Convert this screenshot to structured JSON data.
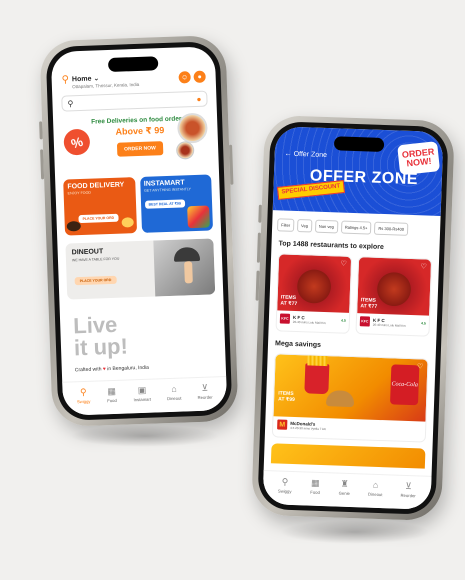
{
  "home": {
    "location_title": "Home",
    "location_sub": "Ottapalam, Thrissur, Kerala, India",
    "promo_line1": "Free Deliveries on food orders",
    "promo_line2": "Above ₹ 99",
    "promo_button": "ORDER NOW",
    "promo_badge": "%",
    "food_delivery": {
      "title": "FOOD DELIVERY",
      "sub": "ENJOY FOOD",
      "button": "PLACE YOUR ORD"
    },
    "instamart": {
      "title": "INSTAMART",
      "sub": "GET ANYTHING INSTANTLY",
      "button": "BEST DEAL AT ₹99"
    },
    "dineout": {
      "title": "DINEOUT",
      "sub": "WE HAVE A TABLE FOR YOU",
      "button": "PLACE YOUR ORD"
    },
    "live_line1": "Live",
    "live_line2": "it up!",
    "crafted_prefix": "Crafted with",
    "crafted_suffix": "in Bengaluru, India",
    "tabs": [
      {
        "label": "Swiggy",
        "icon": "swiggy-icon",
        "active": true
      },
      {
        "label": "Food",
        "icon": "food-icon",
        "active": false
      },
      {
        "label": "Instamart",
        "icon": "instamart-icon",
        "active": false
      },
      {
        "label": "Dineout",
        "icon": "dineout-icon",
        "active": false
      },
      {
        "label": "Reorder",
        "icon": "cart-icon",
        "active": false
      }
    ]
  },
  "offer": {
    "back_label": "Offer Zone",
    "title": "OFFER ZONE",
    "order_now_badge": "ORDER NOW!",
    "special_badge": "SPECIAL DISCOUNT",
    "filters": [
      "Filter",
      "Veg",
      "Non veg",
      "Ratings 4.5+",
      "Rs 300-Rs400"
    ],
    "section_title": "Top 1488 restaurants to explore",
    "restaurants": [
      {
        "items": "ITEMS",
        "price": "AT ₹77",
        "logo": "KFC",
        "name": "K F C",
        "meta": "20-40 mins  Lulu Mall Km",
        "rating": "4.5"
      },
      {
        "items": "ITEMS",
        "price": "AT ₹77",
        "logo": "KFC",
        "name": "K F C",
        "meta": "20-40 mins  Lulu Mall Km",
        "rating": "4.5"
      }
    ],
    "mega_title": "Mega savings",
    "mega": {
      "items": "ITEMS",
      "price": "AT ₹99",
      "logo": "M",
      "name": "McDonald's",
      "meta": "4.5 20-30 mins  Vyttila 7 km",
      "coke": "Coca-Cola"
    },
    "tabs": [
      {
        "label": "Swiggy",
        "icon": "swiggy-icon"
      },
      {
        "label": "Food",
        "icon": "food-icon"
      },
      {
        "label": "Genie",
        "icon": "genie-icon"
      },
      {
        "label": "Dineout",
        "icon": "dineout-icon"
      },
      {
        "label": "Reorder",
        "icon": "cart-icon"
      }
    ]
  },
  "colors": {
    "swiggy_orange": "#fc8019",
    "offer_blue": "#1b4fd6",
    "kfc_red": "#c8102e"
  }
}
